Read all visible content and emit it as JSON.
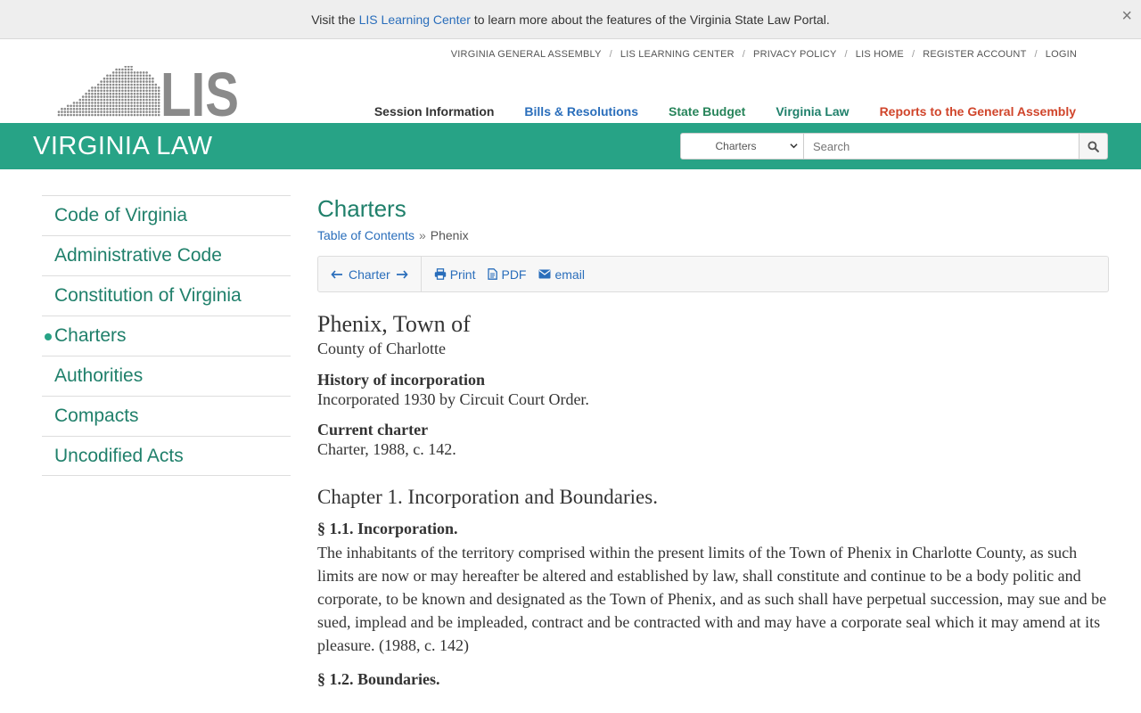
{
  "notice": {
    "prefix": "Visit the ",
    "link": "LIS Learning Center",
    "suffix": " to learn more about the features of the Virginia State Law Portal.",
    "close": "×"
  },
  "logo": {
    "text": "LIS"
  },
  "utility_nav": [
    "VIRGINIA GENERAL ASSEMBLY",
    "LIS LEARNING CENTER",
    "PRIVACY POLICY",
    "LIS HOME",
    "REGISTER ACCOUNT",
    "LOGIN"
  ],
  "utility_sep": "/",
  "main_nav": [
    {
      "label": "Session Information",
      "color": "#333333"
    },
    {
      "label": "Bills & Resolutions",
      "color": "#2a6ebb"
    },
    {
      "label": "State Budget",
      "color": "#27845a"
    },
    {
      "label": "Virginia Law",
      "color": "#20806b"
    },
    {
      "label": "Reports to the General Assembly",
      "color": "#d0452b"
    }
  ],
  "band": {
    "title": "VIRGINIA LAW",
    "color": "#27a386",
    "select_value": "Charters",
    "search_placeholder": "Search"
  },
  "sidebar": {
    "items": [
      "Code of Virginia",
      "Administrative Code",
      "Constitution of Virginia",
      "Charters",
      "Authorities",
      "Compacts",
      "Uncodified Acts"
    ],
    "active_index": 3
  },
  "main": {
    "title": "Charters",
    "breadcrumb": {
      "link": "Table of Contents",
      "sep": "»",
      "current": "Phenix"
    },
    "toolbar": {
      "nav_label": "Charter",
      "print": "Print",
      "pdf": "PDF",
      "email": "email"
    },
    "town": "Phenix, Town of",
    "county": "County of Charlotte",
    "history_label": "History of incorporation",
    "history_text": "Incorporated 1930 by Circuit Court Order.",
    "charter_label": "Current charter",
    "charter_text": "Charter, 1988, c. 142.",
    "chapter": "Chapter 1. Incorporation and Boundaries.",
    "sec1_title": "§ 1.1. Incorporation.",
    "sec1_text": "The inhabitants of the territory comprised within the present limits of the Town of Phenix in Charlotte County, as such limits are now or may hereafter be altered and established by law, shall constitute and continue to be a body politic and corporate, to be known and designated as the Town of Phenix, and as such shall have perpetual succession, may sue and be sued, implead and be impleaded, contract and be contracted with and may have a corporate seal which it may amend at its pleasure.  (1988, c. 142)",
    "sec2_title": "§ 1.2. Boundaries."
  },
  "icons": {
    "close": "close-icon",
    "search": "search-icon",
    "arrow_left": "arrow-left-icon",
    "arrow_right": "arrow-right-icon",
    "print": "print-icon",
    "pdf": "pdf-icon",
    "email": "envelope-icon"
  }
}
